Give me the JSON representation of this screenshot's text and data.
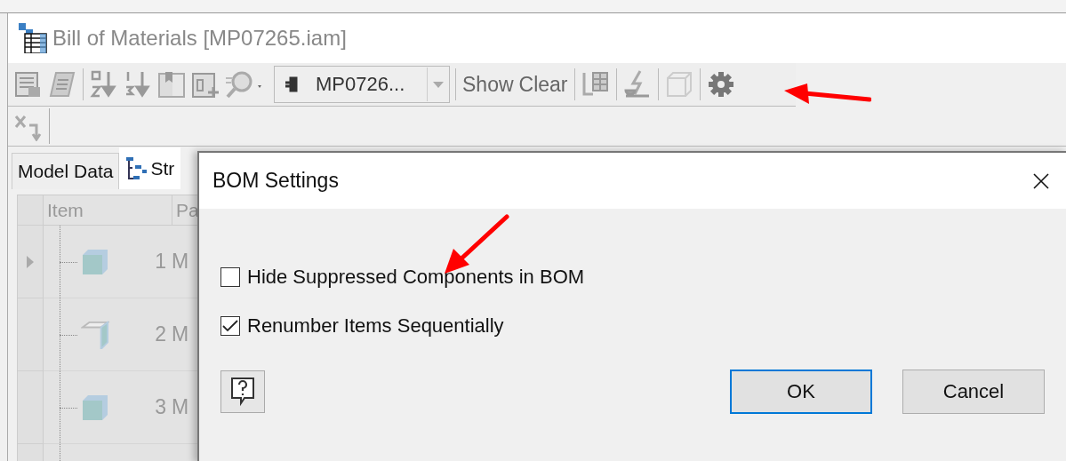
{
  "window": {
    "title": "Bill of Materials [MP07265.iam]"
  },
  "toolbar": {
    "assembly_dropdown": {
      "value": "MP0726..."
    },
    "buttons": [
      {
        "label": "Show"
      },
      {
        "label": "Clear"
      }
    ]
  },
  "tabs": [
    {
      "label": "Model Data",
      "selected": false
    },
    {
      "label": "Str",
      "selected": true
    }
  ],
  "table": {
    "columns": [
      "Item",
      "Pa"
    ],
    "rows": [
      {
        "item": "1",
        "part": "M",
        "kind": "block",
        "current": true
      },
      {
        "item": "2",
        "part": "M",
        "kind": "bent",
        "current": false
      },
      {
        "item": "3",
        "part": "M",
        "kind": "block",
        "current": false
      }
    ]
  },
  "dialog": {
    "title": "BOM Settings",
    "options": [
      {
        "label": "Hide Suppressed Components in BOM",
        "checked": false
      },
      {
        "label": "Renumber Items Sequentially",
        "checked": true
      }
    ],
    "buttons": [
      {
        "label": "OK",
        "default": true
      },
      {
        "label": "Cancel",
        "default": false
      }
    ]
  }
}
